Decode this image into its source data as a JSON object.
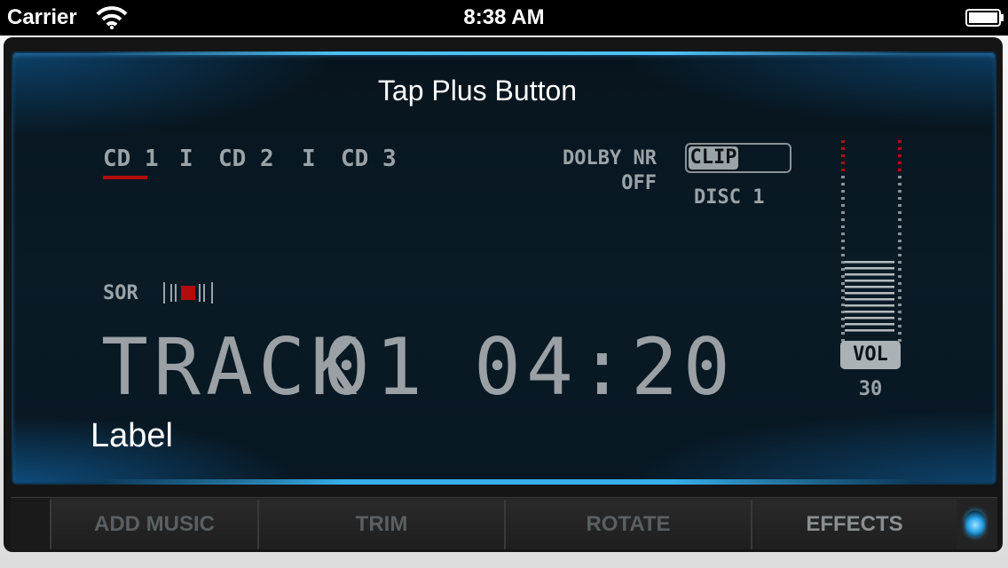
{
  "status_bar": {
    "carrier": "Carrier",
    "time": "8:38 AM",
    "wifi_icon": "wifi-icon",
    "battery_icon": "battery-icon"
  },
  "screen": {
    "title": "Tap Plus Button",
    "cd_tabs": [
      {
        "label": "CD 1",
        "selected": true
      },
      {
        "label": "CD 2",
        "selected": false
      },
      {
        "label": "CD 3",
        "selected": false
      }
    ],
    "cd_separator": "I",
    "dolby": {
      "label": "DOLBY NR",
      "value": "OFF"
    },
    "clip": {
      "label": "CLIP"
    },
    "disc": "DISC 1",
    "sor": "SOR",
    "track": {
      "label": "TRACK",
      "number": "01",
      "time": "04:20"
    },
    "label": "Label",
    "volume": {
      "badge": "VOL",
      "value": "30"
    }
  },
  "toolbar": {
    "buttons": [
      "ADD MUSIC",
      "TRIM",
      "ROTATE",
      "EFFECTS"
    ],
    "power_icon": "power-light-icon"
  },
  "colors": {
    "lcd_text": "#9aa3a8",
    "selected_underline": "#b30c0c",
    "meter_red": "#b30c0c",
    "glow_blue": "#50c8ff"
  }
}
